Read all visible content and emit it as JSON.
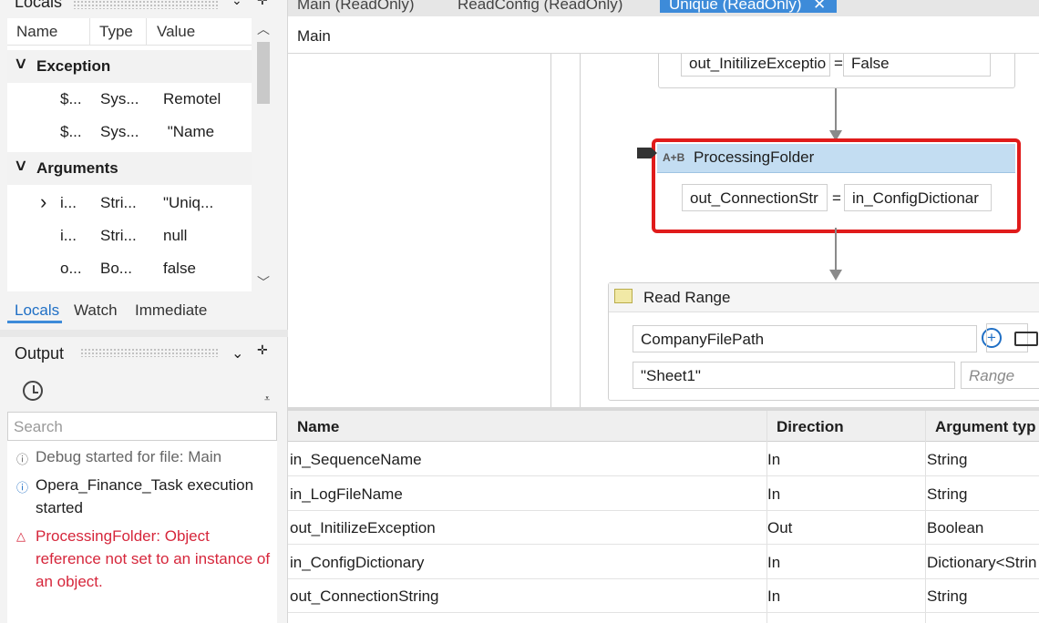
{
  "locals": {
    "title": "Locals",
    "columns": [
      "Name",
      "Type",
      "Value"
    ],
    "rows": [
      {
        "kind": "group",
        "expander": "˅",
        "name": "Exception"
      },
      {
        "kind": "item",
        "expander": "",
        "name": "$...",
        "type": "Sys...",
        "value": "Remotel"
      },
      {
        "kind": "item",
        "expander": "",
        "name": "$...",
        "type": "Sys...",
        "value": " \"Name"
      },
      {
        "kind": "group",
        "expander": "˅",
        "name": "Arguments"
      },
      {
        "kind": "item",
        "expander": "›",
        "name": "i...",
        "type": "Stri...",
        "value": "\"Uniq..."
      },
      {
        "kind": "item",
        "expander": "",
        "name": "i...",
        "type": "Stri...",
        "value": "null"
      },
      {
        "kind": "item",
        "expander": "",
        "name": "o...",
        "type": "Bo...",
        "value": "false"
      }
    ],
    "tabs": [
      "Locals",
      "Watch",
      "Immediate"
    ]
  },
  "output": {
    "title": "Output",
    "search_placeholder": "Search",
    "messages": [
      {
        "icon": "ⓘ",
        "level": "debug",
        "text": "Debug started for file: Main"
      },
      {
        "icon": "ⓘ",
        "level": "info",
        "text": "Opera_Finance_Task execution started"
      },
      {
        "icon": "△",
        "level": "error",
        "text": "ProcessingFolder: Object reference not set to an instance of an object."
      }
    ]
  },
  "doc_tabs": [
    "Main (ReadOnly)",
    "ReadConfig (ReadOnly)",
    "Unique (ReadOnly)"
  ],
  "breadcrumb": "Main",
  "designer": {
    "assign1": {
      "left": "out_InitilizeExceptio",
      "eq": "=",
      "right": "False"
    },
    "processing": {
      "title": "ProcessingFolder",
      "icon": "A+B",
      "left": "out_ConnectionStr",
      "eq": "=",
      "right": "in_ConfigDictionar"
    },
    "read_range": {
      "title": "Read Range",
      "path": "CompanyFilePath",
      "sheet": "\"Sheet1\"",
      "range_placeholder": "Range"
    }
  },
  "arguments": {
    "columns": [
      "Name",
      "Direction",
      "Argument typ"
    ],
    "rows": [
      {
        "name": "in_SequenceName",
        "direction": "In",
        "type": "String"
      },
      {
        "name": "in_LogFileName",
        "direction": "In",
        "type": "String"
      },
      {
        "name": "out_InitilizeException",
        "direction": "Out",
        "type": "Boolean"
      },
      {
        "name": "in_ConfigDictionary",
        "direction": "In",
        "type": "Dictionary<Strin"
      },
      {
        "name": "out_ConnectionString",
        "direction": "In",
        "type": "String"
      }
    ]
  },
  "colors": {
    "accent": "#3d8bd9",
    "error": "#d6263b",
    "selected_border": "#e01b1b",
    "activity_header": "#c3ddf2"
  }
}
